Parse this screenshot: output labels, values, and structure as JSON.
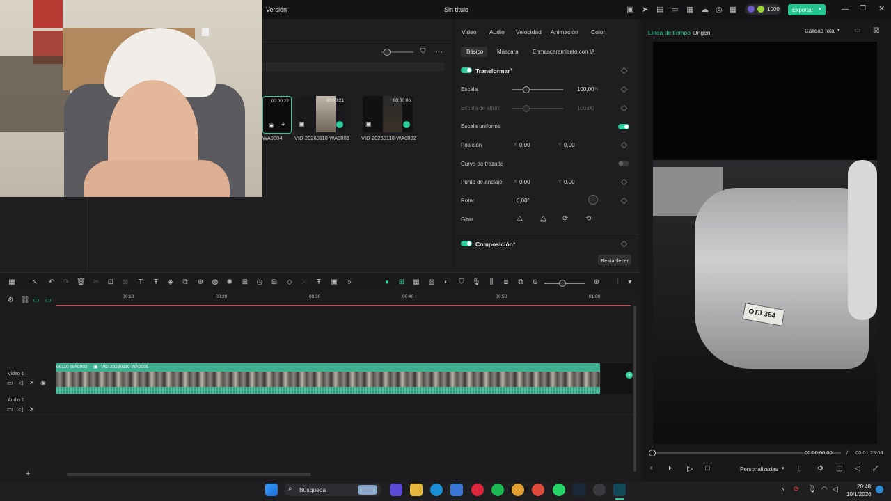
{
  "titlebar": {
    "version_label": "Versión",
    "title": "Sin título",
    "credits": "1000",
    "export_label": "Exportar"
  },
  "media": {
    "clips": [
      {
        "name": "WA0004",
        "duration": "00:00:22"
      },
      {
        "name": "VID-20260110-WA0003",
        "duration": "00:00:21"
      },
      {
        "name": "VID-20260110-WA0002",
        "duration": "00:00:06"
      }
    ]
  },
  "properties": {
    "tabs": [
      "Video",
      "Audio",
      "Velocidad",
      "Animación",
      "Color"
    ],
    "subtabs": [
      "Básico",
      "Máscara",
      "Enmascaramiento con IA"
    ],
    "transform_label": "Transformar",
    "scale_label": "Escala",
    "scale_value": "100,00",
    "scale_unit": "%",
    "scale_height_label": "Escala de altura",
    "scale_height_value": "100,00",
    "uniform_scale_label": "Escala uniforme",
    "position_label": "Posición",
    "pos_x": "0,00",
    "pos_y": "0,00",
    "path_curve_label": "Curva de trazado",
    "anchor_label": "Punto de anclaje",
    "anchor_x": "0,00",
    "anchor_y": "0,00",
    "rotate_label": "Rotar",
    "rotate_value": "0,00°",
    "flip_label": "Girar",
    "composition_label": "Composición",
    "reset_label": "Restablecer",
    "axis_x": "X",
    "axis_y": "Y"
  },
  "preview": {
    "tab_timeline": "Línea de tiempo",
    "tab_source": "Origen",
    "quality": "Calidad total",
    "current_time": "00:00:00:00",
    "separator": "/",
    "total_time": "00:01:23:04",
    "ratio_label": "Personalizadas",
    "plate_text": "OTJ 364"
  },
  "timeline": {
    "ruler": [
      "00:10",
      "00:20",
      "00:30",
      "00:40",
      "00:50",
      "01:00"
    ],
    "track_video": "Video 1",
    "track_audio": "Audio 1",
    "clip_label_1": "00110-WA0002",
    "clip_label_2": "VID-20260110-WA0005"
  },
  "taskbar": {
    "search": "Búsqueda",
    "time": "20:48",
    "date": "10/1/2026"
  },
  "colors": {
    "accent": "#2ecc9a",
    "playhead": "#e0444a",
    "clip": "#3fb08f"
  }
}
